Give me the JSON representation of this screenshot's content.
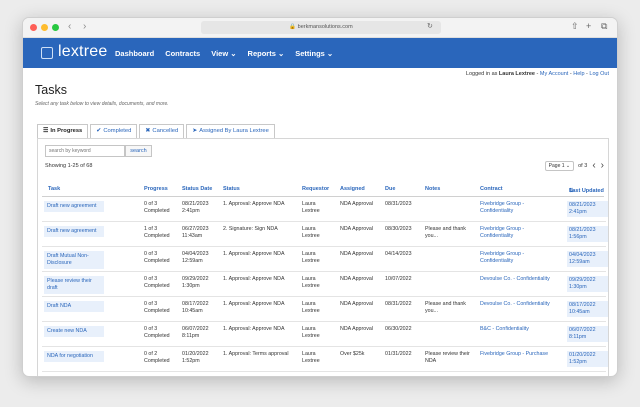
{
  "browser": {
    "url": "berkmansolutions.com",
    "back_icon": "chevron-left-icon",
    "forward_icon": "chevron-right-icon",
    "colors": {
      "close": "#fe5f57",
      "minimize": "#febc2e",
      "zoom": "#28c840"
    }
  },
  "app": {
    "logo": "lextree",
    "brand_color": "#2a66bb",
    "nav": [
      "Dashboard",
      "Contracts",
      "View ⌄",
      "Reports ⌄",
      "Settings ⌄"
    ]
  },
  "user_bar": {
    "prefix": "Logged in as",
    "user": "Laura Lextree",
    "links": [
      "My Account",
      "Help",
      "Log Out"
    ]
  },
  "page": {
    "title": "Tasks",
    "subtitle": "Select any task below to view details, documents, and more."
  },
  "tabs": [
    {
      "label": "In Progress",
      "icon": "list-icon"
    },
    {
      "label": "Completed",
      "icon": "check-circle-icon"
    },
    {
      "label": "Cancelled",
      "icon": "x-icon"
    },
    {
      "label": "Assigned By Laura Lextree",
      "icon": "send-icon"
    }
  ],
  "search": {
    "placeholder": "search by keyword",
    "button": "search"
  },
  "results": {
    "showing": "Showing 1-25 of 68"
  },
  "pager": {
    "page_select": "Page 1",
    "of": "of 3"
  },
  "table": {
    "headers": [
      "Task",
      "Progress",
      "Status Date",
      "Status",
      "Requestor",
      "Assigned",
      "Due",
      "Notes",
      "Contract",
      "Last Updated"
    ],
    "rows": [
      {
        "task": "Draft new agreement",
        "progress": "0 of 3 Completed",
        "status_date": "08/21/2023 2:41pm",
        "status": "1. Approval: Approve NDA",
        "requestor": "Laura Lextree",
        "assigned": "NDA Approval",
        "due": "08/31/2023",
        "notes": "",
        "contract": "Fivebridge Group - Confidentiality",
        "updated": "08/21/2023 2:41pm"
      },
      {
        "task": "Draft new agreement",
        "progress": "1 of 3 Completed",
        "status_date": "06/27/2023 11:43am",
        "status": "2. Signature: Sign NDA",
        "requestor": "Laura Lextree",
        "assigned": "NDA Approval",
        "due": "08/30/2023",
        "notes": "Please and thank you...",
        "contract": "Fivebridge Group - Confidentiality",
        "updated": "08/21/2023 1:56pm"
      },
      {
        "task": "Draft Mutual Non-Disclosure",
        "progress": "0 of 3 Completed",
        "status_date": "04/04/2023 12:59am",
        "status": "1. Approval: Approve NDA",
        "requestor": "Laura Lextree",
        "assigned": "NDA Approval",
        "due": "04/14/2023",
        "notes": "",
        "contract": "Fivebridge Group - Confidentiality",
        "updated": "04/04/2023 12:59am"
      },
      {
        "task": "Please review their draft",
        "progress": "0 of 3 Completed",
        "status_date": "09/29/2022 1:30pm",
        "status": "1. Approval: Approve NDA",
        "requestor": "Laura Lextree",
        "assigned": "NDA Approval",
        "due": "10/07/2022",
        "notes": "",
        "contract": "Devoulse Co. - Confidentiality",
        "updated": "09/29/2022 1:30pm"
      },
      {
        "task": "Draft NDA",
        "progress": "0 of 3 Completed",
        "status_date": "08/17/2022 10:45am",
        "status": "1. Approval: Approve NDA",
        "requestor": "Laura Lextree",
        "assigned": "NDA Approval",
        "due": "08/31/2022",
        "notes": "Please and thank you...",
        "contract": "Devoulse Co. - Confidentiality",
        "updated": "08/17/2022 10:45am"
      },
      {
        "task": "Create new NDA",
        "progress": "0 of 3 Completed",
        "status_date": "06/07/2022 8:11pm",
        "status": "1. Approval: Approve NDA",
        "requestor": "Laura Lextree",
        "assigned": "NDA Approval",
        "due": "06/30/2022",
        "notes": "",
        "contract": "B&C - Confidentiality",
        "updated": "06/07/2022 8:11pm"
      },
      {
        "task": "NDA for negotiation",
        "progress": "0 of 2 Completed",
        "status_date": "01/20/2022 1:52pm",
        "status": "1. Approval: Terms approval",
        "requestor": "Laura Lextree",
        "assigned": "Over $25k",
        "due": "01/31/2022",
        "notes": "Please review their NDA",
        "contract": "Fivebridge Group - Purchase",
        "updated": "01/20/2022 1:52pm"
      }
    ]
  }
}
